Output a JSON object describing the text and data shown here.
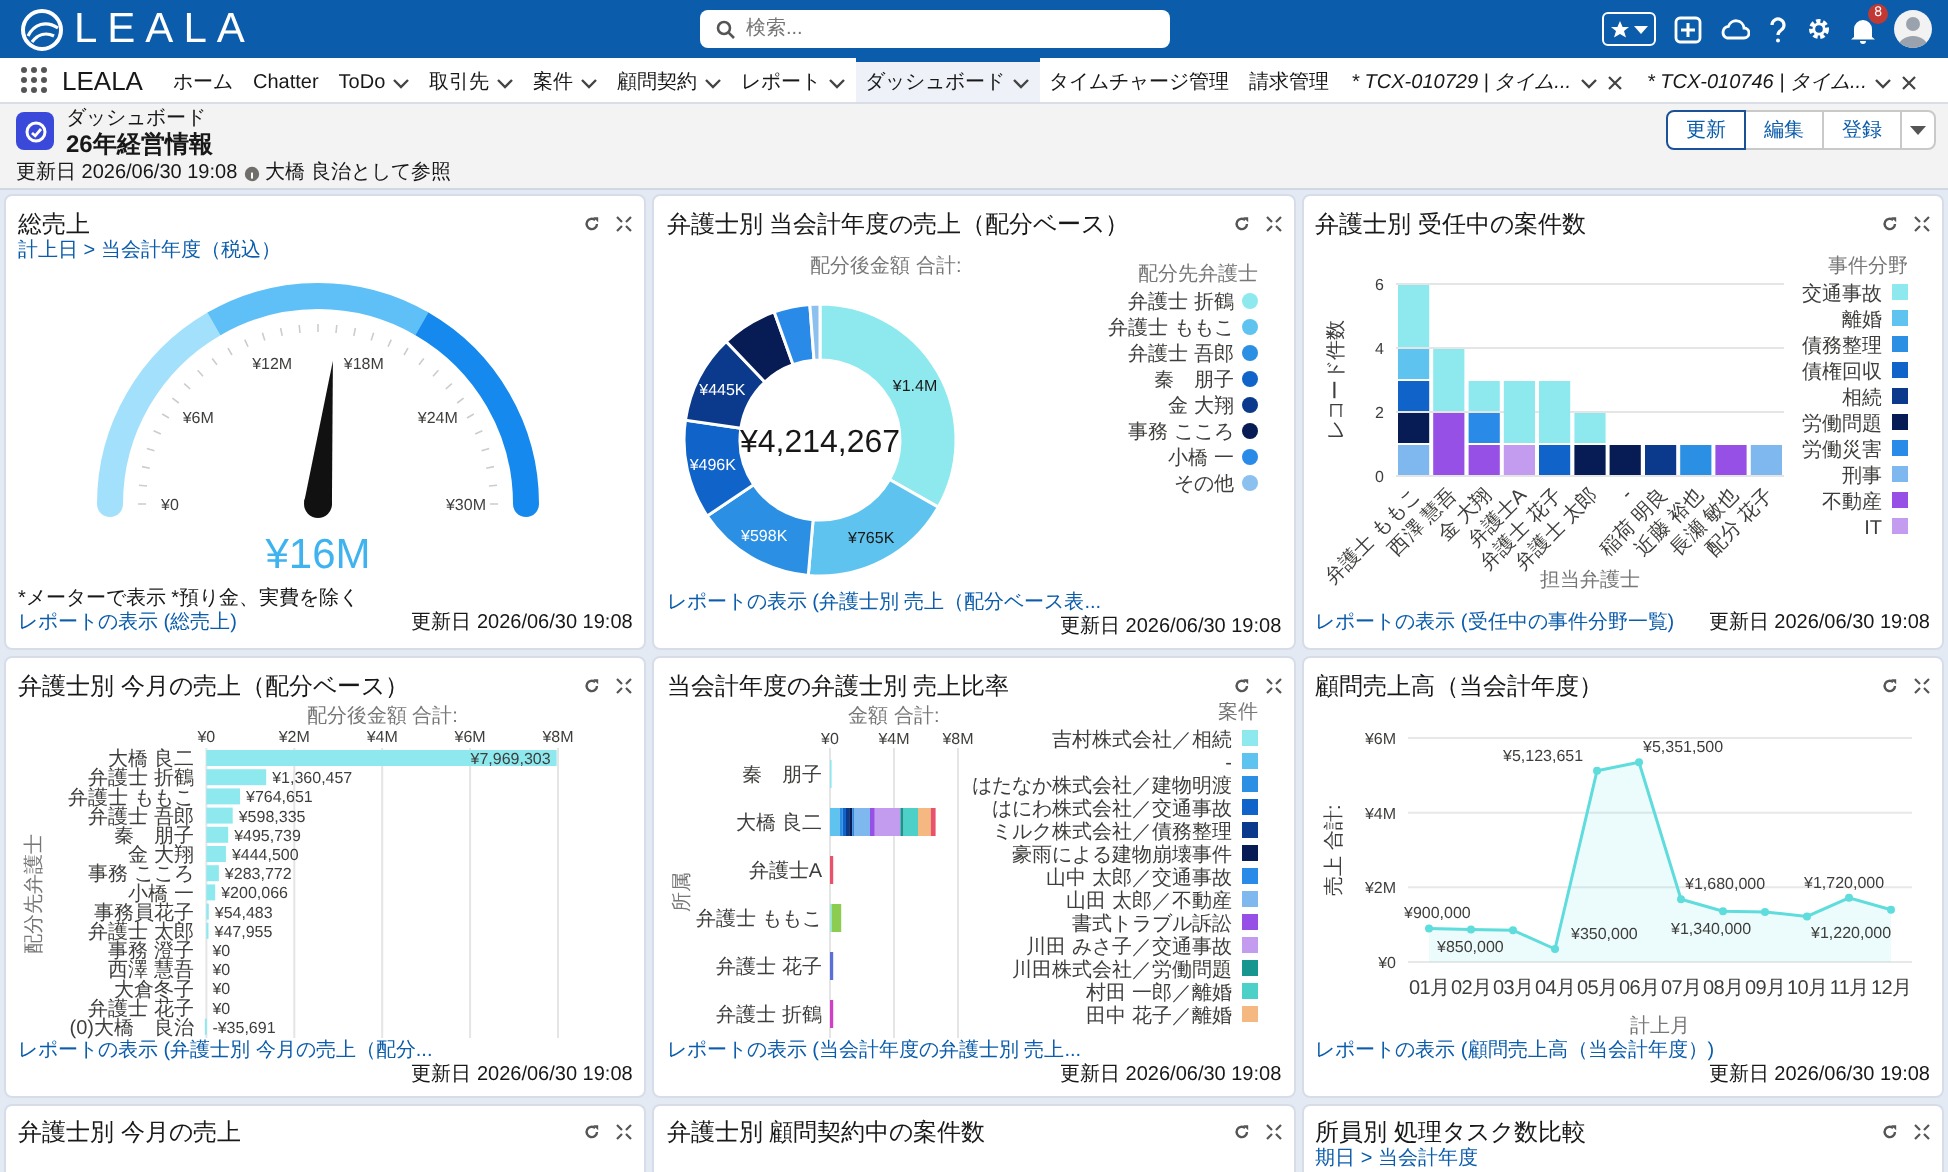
{
  "header": {
    "logo": "LEALA",
    "search": {
      "placeholder": "検索..."
    },
    "notification_count": "8"
  },
  "nav": {
    "app_name": "LEALA",
    "items": [
      {
        "label": "ホーム",
        "kind": "link",
        "selected": false
      },
      {
        "label": "Chatter",
        "kind": "link",
        "selected": false
      },
      {
        "label": "ToDo",
        "kind": "menu",
        "selected": false
      },
      {
        "label": "取引先",
        "kind": "menu",
        "selected": false
      },
      {
        "label": "案件",
        "kind": "menu",
        "selected": false
      },
      {
        "label": "顧問契約",
        "kind": "menu",
        "selected": false
      },
      {
        "label": "レポート",
        "kind": "menu",
        "selected": false
      },
      {
        "label": "ダッシュボード",
        "kind": "menu",
        "selected": true
      },
      {
        "label": "タイムチャージ管理",
        "kind": "link",
        "selected": false
      },
      {
        "label": "請求管理",
        "kind": "link",
        "selected": false
      },
      {
        "label": "* TCX-010729 | タイム...",
        "kind": "record_tab",
        "selected": false
      },
      {
        "label": "* TCX-010746 | タイム...",
        "kind": "record_tab",
        "selected": false
      }
    ]
  },
  "page": {
    "object": "ダッシュボード",
    "title": "26年経営情報",
    "updated": "更新日 2026/06/30 19:08",
    "viewing_as": "大橋 良治として参照",
    "buttons": [
      {
        "label": "更新",
        "selected": true
      },
      {
        "label": "編集",
        "selected": false
      },
      {
        "label": "登録",
        "selected": false
      }
    ]
  },
  "cards": [
    {
      "kind": "gauge",
      "title": "総売上",
      "subtitle": "計上日 > 当会計年度（税込）",
      "gauge": {
        "ticks": [
          "¥0",
          "¥6M",
          "¥12M",
          "¥18M",
          "¥24M",
          "¥30M"
        ],
        "level": 0.533,
        "value": "¥16M"
      },
      "note": "*メーターで表示 *預り金、実費を除く",
      "link": "レポートの表示 (総売上)",
      "updated": "更新日 2026/06/30 19:08"
    },
    {
      "kind": "chart",
      "title": "弁護士別 当会計年度の売上（配分ベース）",
      "total": "¥4,214,267",
      "link": "レポートの表示 (弁護士別 売上（配分ベース表...",
      "updated": "更新日 2026/06/30 19:08",
      "chart_data": {
        "type": "donut",
        "title": "配分後金額 合計:",
        "legend": {
          "title": "配分先弁護士"
        },
        "categories": [
          "弁護士 折鶴",
          "弁護士 ももこ",
          "弁護士 吾郎",
          "秦　朋子",
          "金 大翔",
          "事務 こころ",
          "小橋 一",
          "その他"
        ],
        "values": [
          1400000,
          765000,
          598000,
          496000,
          445000,
          280000,
          180000,
          50267
        ],
        "colors": [
          "#8ee9ef",
          "#5ec4ef",
          "#2b8fe3",
          "#0f63c9",
          "#0b3a8c",
          "#071c55",
          "#2a8ae8",
          "#8cc0ef"
        ],
        "value_labels": [
          "¥1.4M",
          "¥765K",
          "¥598K",
          "¥496K",
          "¥445K",
          null,
          null,
          null
        ]
      }
    },
    {
      "kind": "chart",
      "title": "弁護士別 受任中の案件数",
      "link": "レポートの表示 (受任中の事件分野一覧)",
      "updated": "更新日 2026/06/30 19:08",
      "chart_data": {
        "type": "bar",
        "stacked": true,
        "grid": true,
        "legend": {
          "title": "事件分野"
        },
        "xlabel": "担当弁護士",
        "ylabel": "レコード件数",
        "ylim": [
          0,
          6
        ],
        "yticks": [
          0,
          2,
          4,
          6
        ],
        "categories": [
          "弁護士 ももこ",
          "西澤 慧吾",
          "金 大翔",
          "弁護士A",
          "弁護士 花子",
          "弁護士 太郎",
          "-",
          "稲荷 明良",
          "近藤 裕也",
          "長瀬 敏也",
          "配分 花子"
        ],
        "series": [
          {
            "name": "交通事故",
            "color": "#8ee9ef",
            "values": [
              2,
              2,
              1,
              2,
              2,
              1,
              0,
              0,
              0,
              0,
              0
            ]
          },
          {
            "name": "離婚",
            "color": "#5ec4ef",
            "values": [
              1,
              0,
              0,
              0,
              0,
              0,
              0,
              0,
              0,
              0,
              0
            ]
          },
          {
            "name": "債務整理",
            "color": "#2b8fe3",
            "values": [
              0,
              0,
              0,
              0,
              0,
              0,
              0,
              0,
              1,
              0,
              0
            ]
          },
          {
            "name": "債権回収",
            "color": "#0f63c9",
            "values": [
              1,
              0,
              0,
              0,
              1,
              0,
              0,
              0,
              0,
              0,
              0
            ]
          },
          {
            "name": "相続",
            "color": "#0b3a8c",
            "values": [
              0,
              0,
              0,
              0,
              0,
              0,
              0,
              1,
              0,
              0,
              0
            ]
          },
          {
            "name": "労働問題",
            "color": "#071c55",
            "values": [
              1,
              0,
              0,
              0,
              0,
              1,
              1,
              0,
              0,
              0,
              0
            ]
          },
          {
            "name": "労働災害",
            "color": "#2a8ae8",
            "values": [
              0,
              0,
              1,
              0,
              0,
              0,
              0,
              0,
              0,
              0,
              0
            ]
          },
          {
            "name": "刑事",
            "color": "#7fb8ee",
            "values": [
              1,
              0,
              0,
              0,
              0,
              0,
              0,
              0,
              0,
              0,
              1
            ]
          },
          {
            "name": "不動産",
            "color": "#9650e6",
            "values": [
              0,
              2,
              1,
              0,
              0,
              0,
              0,
              0,
              0,
              1,
              0
            ]
          },
          {
            "name": "IT",
            "color": "#c39bef",
            "values": [
              0,
              0,
              0,
              1,
              0,
              0,
              0,
              0,
              0,
              0,
              0
            ]
          }
        ]
      }
    },
    {
      "kind": "chart",
      "title": "弁護士別 今月の売上（配分ベース）",
      "link": "レポートの表示 (弁護士別 今月の売上（配分...",
      "updated": "更新日 2026/06/30 19:08",
      "chart_data": {
        "type": "bar",
        "orientation": "horizontal",
        "grid": true,
        "title": "配分後金額 合計:",
        "ylabel": "配分先弁護士",
        "xlim": [
          -100000,
          8000000
        ],
        "xticks": [
          {
            "value": 0,
            "label": "¥0"
          },
          {
            "value": 2000000,
            "label": "¥2M"
          },
          {
            "value": 4000000,
            "label": "¥4M"
          },
          {
            "value": 6000000,
            "label": "¥6M"
          },
          {
            "value": 8000000,
            "label": "¥8M"
          }
        ],
        "categories": [
          "大橋 良二",
          "弁護士 折鶴",
          "弁護士 ももこ",
          "弁護士 吾郎",
          "秦　朋子",
          "金 大翔",
          "事務 こころ",
          "小橋 一",
          "事務員花子",
          "弁護士 太郎",
          "事務 澄子",
          "西澤 慧吾",
          "大倉冬子",
          "弁護士 花子",
          "(0)大橋　良治"
        ],
        "values": [
          7969303,
          1360457,
          764651,
          598335,
          495739,
          444500,
          283772,
          200066,
          54483,
          47955,
          0,
          0,
          0,
          0,
          -35691
        ],
        "value_labels": [
          "¥7,969,303",
          "¥1,360,457",
          "¥764,651",
          "¥598,335",
          "¥495,739",
          "¥444,500",
          "¥283,772",
          "¥200,066",
          "¥54,483",
          "¥47,955",
          "¥0",
          "¥0",
          "¥0",
          "¥0",
          "-¥35,691"
        ]
      }
    },
    {
      "kind": "chart",
      "title": "当会計年度の弁護士別 売上比率",
      "link": "レポートの表示 (当会計年度の弁護士別 売上...",
      "updated": "更新日 2026/06/30 19:08",
      "chart_data": {
        "type": "bar",
        "orientation": "horizontal",
        "stacked": true,
        "grid": true,
        "legend": {
          "title": "案件"
        },
        "title": "金額 合計:",
        "ylabel": "所属",
        "xlim": [
          0,
          8000000
        ],
        "xticks": [
          {
            "value": 0,
            "label": "¥0"
          },
          {
            "value": 4000000,
            "label": "¥4M"
          },
          {
            "value": 8000000,
            "label": "¥8M"
          }
        ],
        "categories": [
          "秦　朋子",
          "大橋 良二",
          "弁護士A",
          "弁護士 ももこ",
          "弁護士 花子",
          "弁護士 折鶴"
        ],
        "series": [
          {
            "name": "吉村株式会社／相続",
            "color": "#8ee9ef",
            "values": [
              100000,
              0,
              0,
              100000,
              0,
              0
            ]
          },
          {
            "name": "-",
            "color": "#5ec4ef",
            "values": [
              0,
              600000,
              0,
              0,
              0,
              0
            ]
          },
          {
            "name": "はたなか株式会社／建物明渡",
            "color": "#2b8fe3",
            "values": [
              0,
              200000,
              0,
              0,
              0,
              0
            ]
          },
          {
            "name": "はにわ株式会社／交通事故",
            "color": "#0f63c9",
            "values": [
              0,
              200000,
              0,
              0,
              0,
              0
            ]
          },
          {
            "name": "ミルク株式会社／債務整理",
            "color": "#0b3a8c",
            "values": [
              0,
              200000,
              0,
              0,
              0,
              0
            ]
          },
          {
            "name": "豪雨による建物崩壊事件",
            "color": "#071c55",
            "values": [
              0,
              200000,
              0,
              0,
              0,
              0
            ]
          },
          {
            "name": "山中 太郎／交通事故",
            "color": "#2a8ae8",
            "values": [
              0,
              100000,
              0,
              0,
              0,
              0
            ]
          },
          {
            "name": "山田 太郎／不動産",
            "color": "#7fb8ee",
            "values": [
              0,
              1000000,
              0,
              0,
              0,
              0
            ]
          },
          {
            "name": "書式トラブル訴訟",
            "color": "#9650e6",
            "values": [
              0,
              300000,
              0,
              0,
              0,
              0
            ]
          },
          {
            "name": "川田 みさ子／交通事故",
            "color": "#c39bef",
            "values": [
              0,
              1600000,
              0,
              0,
              0,
              0
            ]
          },
          {
            "name": "川田株式会社／労働問題",
            "color": "#16968e",
            "values": [
              0,
              200000,
              0,
              0,
              0,
              0
            ]
          },
          {
            "name": "村田 一郎／離婚",
            "color": "#4dd0c8",
            "values": [
              0,
              900000,
              0,
              0,
              0,
              0
            ]
          },
          {
            "name": "田中 花子／離婚",
            "color": "#f5b880",
            "values": [
              0,
              800000,
              0,
              0,
              0,
              0
            ]
          },
          {
            "color": "#e8536b",
            "values": [
              0,
              300000,
              200000,
              0,
              0,
              0
            ]
          },
          {
            "color": "#8ccc50",
            "values": [
              0,
              0,
              0,
              600000,
              0,
              0
            ]
          },
          {
            "color": "#5b6fd8",
            "values": [
              0,
              0,
              0,
              0,
              200000,
              0
            ]
          },
          {
            "color": "#d13fc6",
            "values": [
              0,
              0,
              0,
              0,
              0,
              200000
            ]
          }
        ]
      }
    },
    {
      "kind": "chart",
      "title": "顧問売上高（当会計年度）",
      "link": "レポートの表示 (顧問売上高（当会計年度）)",
      "updated": "更新日 2026/06/30 19:08",
      "chart_data": {
        "type": "area",
        "grid": true,
        "xlabel": "計上月",
        "ylabel": "売上 合計:",
        "ylim": [
          0,
          6000000
        ],
        "yticks": [
          {
            "value": 0,
            "label": "¥0"
          },
          {
            "value": 2000000,
            "label": "¥2M"
          },
          {
            "value": 4000000,
            "label": "¥4M"
          },
          {
            "value": 6000000,
            "label": "¥6M"
          }
        ],
        "categories": [
          "01月",
          "02月",
          "03月",
          "04月",
          "05月",
          "06月",
          "07月",
          "08月",
          "09月",
          "10月",
          "11月",
          "12月"
        ],
        "series": [
          {
            "color": "#5fdcdc",
            "values": [
              900000,
              870000,
              850000,
              350000,
              5123651,
              5351500,
              1680000,
              1360000,
              1340000,
              1220000,
              1720000,
              1400000
            ]
          }
        ],
        "value_labels": [
          "¥900,000",
          null,
          "¥850,000",
          "¥350,000",
          "¥5,123,651",
          "¥5,351,500",
          "¥1,680,000",
          null,
          "¥1,340,000",
          "¥1,220,000",
          "¥1,720,000",
          null
        ]
      }
    },
    {
      "title": "弁護士別 今月の売上"
    },
    {
      "title": "弁護士別 顧問契約中の案件数"
    },
    {
      "title": "所員別 処理タスク数比較",
      "subtitle": "期日 > 当会計年度"
    }
  ]
}
